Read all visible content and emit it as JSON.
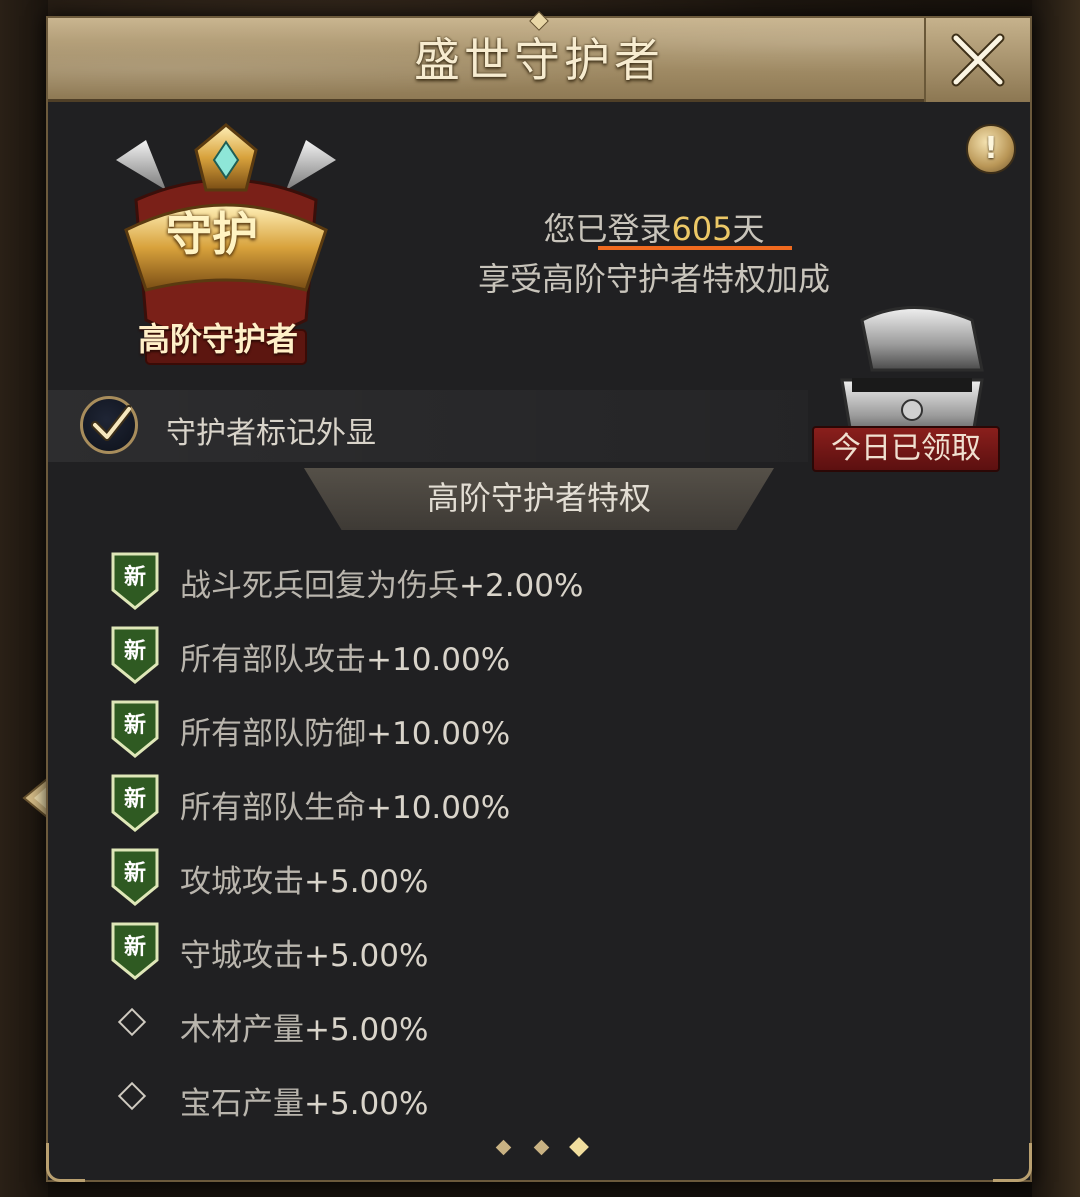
{
  "header": {
    "title": "盛世守护者"
  },
  "emblem": {
    "badge_text": "守护",
    "rank_label": "高阶守护者"
  },
  "login": {
    "prefix": "您已登录",
    "days": "605",
    "suffix": "天",
    "bonus_text": "享受高阶守护者特权加成"
  },
  "daily_reward": {
    "claimed_label": "今日已领取"
  },
  "toggle": {
    "label": "守护者标记外显",
    "checked": true
  },
  "section": {
    "title": "高阶守护者特权"
  },
  "perks": [
    {
      "badge": "新",
      "name": "战斗死兵回复为伤兵",
      "value": "+2.00%",
      "is_new": true
    },
    {
      "badge": "新",
      "name": "所有部队攻击",
      "value": "+10.00%",
      "is_new": true
    },
    {
      "badge": "新",
      "name": "所有部队防御",
      "value": "+10.00%",
      "is_new": true
    },
    {
      "badge": "新",
      "name": "所有部队生命",
      "value": "+10.00%",
      "is_new": true
    },
    {
      "badge": "新",
      "name": "攻城攻击",
      "value": "+5.00%",
      "is_new": true
    },
    {
      "badge": "新",
      "name": "守城攻击",
      "value": "+5.00%",
      "is_new": true
    },
    {
      "badge": "",
      "name": "木材产量",
      "value": "+5.00%",
      "is_new": false
    },
    {
      "badge": "",
      "name": "宝石产量",
      "value": "+5.00%",
      "is_new": false
    }
  ],
  "pager": {
    "total": 3,
    "current": 3
  },
  "colors": {
    "accent_gold": "#ecc867",
    "underline_orange": "#f06a1f",
    "claimed_red": "#8a1f1c",
    "new_badge_green": "#3d6b2b"
  }
}
